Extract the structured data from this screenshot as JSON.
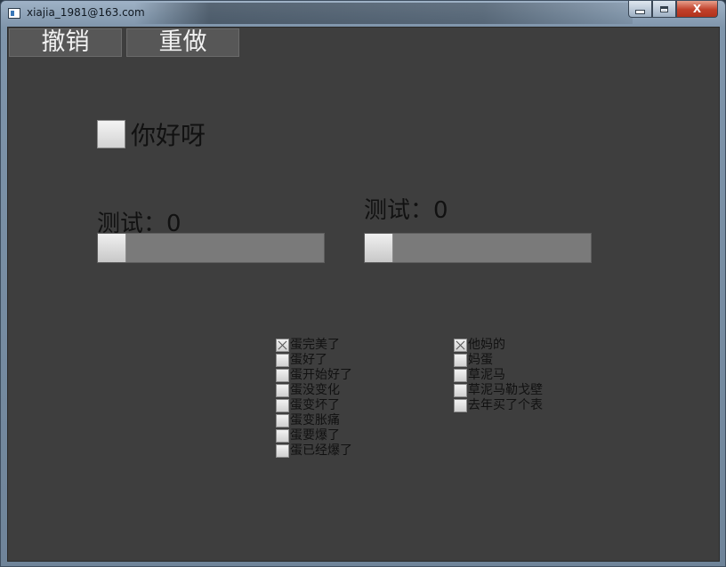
{
  "window": {
    "title": "xiajia_1981@163.com",
    "minimize_label": "",
    "maximize_label": "",
    "close_label": "X"
  },
  "toolbar": {
    "undo_label": "撤销",
    "redo_label": "重做"
  },
  "main_checkbox": {
    "label": "你好呀",
    "checked": false
  },
  "sliders": [
    {
      "label": "测试：0",
      "value": 0
    },
    {
      "label": "测试：0",
      "value": 0
    }
  ],
  "checkbox_group_left": [
    {
      "label": "蛋完美了",
      "checked": true
    },
    {
      "label": "蛋好了",
      "checked": false
    },
    {
      "label": "蛋开始好了",
      "checked": false
    },
    {
      "label": "蛋没变化",
      "checked": false
    },
    {
      "label": "蛋变坏了",
      "checked": false
    },
    {
      "label": "蛋变胀痛",
      "checked": false
    },
    {
      "label": "蛋要爆了",
      "checked": false
    },
    {
      "label": "蛋已经爆了",
      "checked": false
    }
  ],
  "checkbox_group_right": [
    {
      "label": "他妈的",
      "checked": true
    },
    {
      "label": "妈蛋",
      "checked": false
    },
    {
      "label": "草泥马",
      "checked": false
    },
    {
      "label": "草泥马勒戈壁",
      "checked": false
    },
    {
      "label": "去年买了个表",
      "checked": false
    }
  ],
  "colors": {
    "client_background": "#3e3e3e",
    "button_background": "#575757",
    "slider_track": "#7a7a7a",
    "close_button": "#c0402a"
  }
}
